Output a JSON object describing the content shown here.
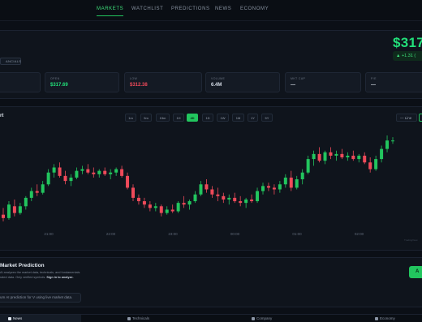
{
  "nav": {
    "items": [
      {
        "label": "MARKETS",
        "active": true
      },
      {
        "label": "WATCHLIST",
        "active": false
      },
      {
        "label": "PREDICTIONS",
        "active": false
      },
      {
        "label": "NEWS",
        "active": false
      },
      {
        "label": "ECONOMY",
        "active": false
      }
    ]
  },
  "header": {
    "badge": "ANCIALS",
    "price": "$317",
    "change": "▲ +1.31 ("
  },
  "stats": [
    {
      "label": "",
      "value": ""
    },
    {
      "label": "OPEN",
      "value": "$317.69",
      "tone": "green"
    },
    {
      "label": "LOW",
      "value": "$312.38",
      "tone": "red"
    },
    {
      "label": "VOLUME",
      "value": "6.4M",
      "tone": "plain"
    },
    {
      "label": "MKT CAP",
      "value": "—",
      "tone": "plain"
    },
    {
      "label": "P/E",
      "value": "—",
      "tone": "plain"
    }
  ],
  "chart_panel": {
    "title": "rt",
    "timeframes": [
      "1m",
      "5m",
      "15m",
      "1H",
      "4D",
      "1D",
      "1W",
      "1M",
      "1Y",
      "5Y"
    ],
    "timeframe_active": "4D",
    "chart_type": "— Line",
    "x_ticks": [
      "21:00",
      "22:00",
      "23:00",
      "00:00",
      "01:00",
      "02:00"
    ],
    "watermark": "TradingView"
  },
  "chart_data": {
    "type": "candlestick",
    "x_ticks": [
      "21:00",
      "22:00",
      "23:00",
      "00:00",
      "01:00",
      "02:00"
    ],
    "up_color": "#22c55e",
    "down_color": "#ef4a5a",
    "candles": [
      {
        "o": 312.8,
        "h": 313.2,
        "l": 312.4,
        "c": 312.6
      },
      {
        "o": 312.6,
        "h": 313.6,
        "l": 312.5,
        "c": 313.4
      },
      {
        "o": 313.3,
        "h": 313.7,
        "l": 312.7,
        "c": 312.9
      },
      {
        "o": 312.9,
        "h": 313.5,
        "l": 312.8,
        "c": 313.3
      },
      {
        "o": 313.3,
        "h": 313.9,
        "l": 313.1,
        "c": 313.8
      },
      {
        "o": 313.8,
        "h": 314.4,
        "l": 313.6,
        "c": 314.2
      },
      {
        "o": 314.2,
        "h": 314.6,
        "l": 313.9,
        "c": 314.1
      },
      {
        "o": 314.1,
        "h": 314.8,
        "l": 314.0,
        "c": 314.6
      },
      {
        "o": 314.6,
        "h": 315.5,
        "l": 314.5,
        "c": 315.3
      },
      {
        "o": 315.3,
        "h": 315.8,
        "l": 315.0,
        "c": 315.6
      },
      {
        "o": 315.6,
        "h": 315.9,
        "l": 315.0,
        "c": 315.1
      },
      {
        "o": 315.1,
        "h": 315.4,
        "l": 314.6,
        "c": 314.8
      },
      {
        "o": 314.8,
        "h": 315.2,
        "l": 314.5,
        "c": 315.0
      },
      {
        "o": 315.0,
        "h": 315.6,
        "l": 314.9,
        "c": 315.4
      },
      {
        "o": 315.4,
        "h": 315.7,
        "l": 315.2,
        "c": 315.5
      },
      {
        "o": 315.5,
        "h": 315.8,
        "l": 315.2,
        "c": 315.3
      },
      {
        "o": 315.3,
        "h": 315.6,
        "l": 315.0,
        "c": 315.2
      },
      {
        "o": 315.2,
        "h": 315.5,
        "l": 315.0,
        "c": 315.4
      },
      {
        "o": 315.4,
        "h": 315.6,
        "l": 315.1,
        "c": 315.2
      },
      {
        "o": 315.2,
        "h": 315.5,
        "l": 314.9,
        "c": 315.3
      },
      {
        "o": 315.3,
        "h": 315.6,
        "l": 315.1,
        "c": 315.5
      },
      {
        "o": 315.5,
        "h": 315.7,
        "l": 315.0,
        "c": 315.1
      },
      {
        "o": 315.1,
        "h": 315.3,
        "l": 314.3,
        "c": 314.4
      },
      {
        "o": 314.4,
        "h": 314.6,
        "l": 313.6,
        "c": 313.8
      },
      {
        "o": 313.8,
        "h": 314.0,
        "l": 313.4,
        "c": 313.6
      },
      {
        "o": 313.6,
        "h": 313.8,
        "l": 313.2,
        "c": 313.4
      },
      {
        "o": 313.4,
        "h": 313.6,
        "l": 313.0,
        "c": 313.2
      },
      {
        "o": 313.2,
        "h": 313.5,
        "l": 313.0,
        "c": 313.3
      },
      {
        "o": 313.3,
        "h": 313.4,
        "l": 312.7,
        "c": 312.9
      },
      {
        "o": 312.9,
        "h": 313.3,
        "l": 312.8,
        "c": 313.1
      },
      {
        "o": 313.1,
        "h": 313.4,
        "l": 312.9,
        "c": 313.0
      },
      {
        "o": 313.0,
        "h": 313.6,
        "l": 312.9,
        "c": 313.5
      },
      {
        "o": 313.5,
        "h": 313.9,
        "l": 313.2,
        "c": 313.4
      },
      {
        "o": 313.4,
        "h": 313.7,
        "l": 313.1,
        "c": 313.6
      },
      {
        "o": 313.6,
        "h": 314.2,
        "l": 313.5,
        "c": 314.0
      },
      {
        "o": 314.0,
        "h": 314.8,
        "l": 313.9,
        "c": 314.6
      },
      {
        "o": 314.6,
        "h": 314.9,
        "l": 314.1,
        "c": 314.3
      },
      {
        "o": 314.3,
        "h": 314.5,
        "l": 313.8,
        "c": 314.0
      },
      {
        "o": 314.0,
        "h": 314.4,
        "l": 313.6,
        "c": 313.9
      },
      {
        "o": 313.9,
        "h": 314.1,
        "l": 313.5,
        "c": 313.7
      },
      {
        "o": 313.7,
        "h": 314.0,
        "l": 313.4,
        "c": 313.8
      },
      {
        "o": 313.8,
        "h": 314.1,
        "l": 313.5,
        "c": 313.6
      },
      {
        "o": 313.6,
        "h": 313.9,
        "l": 313.3,
        "c": 313.5
      },
      {
        "o": 313.5,
        "h": 313.8,
        "l": 313.2,
        "c": 313.7
      },
      {
        "o": 313.7,
        "h": 314.0,
        "l": 313.5,
        "c": 313.6
      },
      {
        "o": 313.6,
        "h": 314.4,
        "l": 313.5,
        "c": 314.2
      },
      {
        "o": 314.2,
        "h": 314.7,
        "l": 314.0,
        "c": 314.5
      },
      {
        "o": 314.5,
        "h": 314.7,
        "l": 314.2,
        "c": 314.4
      },
      {
        "o": 314.4,
        "h": 314.6,
        "l": 314.0,
        "c": 314.3
      },
      {
        "o": 314.3,
        "h": 314.8,
        "l": 314.1,
        "c": 314.6
      },
      {
        "o": 314.6,
        "h": 315.2,
        "l": 314.4,
        "c": 315.0
      },
      {
        "o": 315.0,
        "h": 315.4,
        "l": 314.2,
        "c": 314.4
      },
      {
        "o": 314.4,
        "h": 315.1,
        "l": 314.3,
        "c": 314.9
      },
      {
        "o": 314.9,
        "h": 315.5,
        "l": 314.6,
        "c": 315.3
      },
      {
        "o": 315.3,
        "h": 316.3,
        "l": 315.2,
        "c": 316.1
      },
      {
        "o": 316.1,
        "h": 316.6,
        "l": 315.7,
        "c": 316.4
      },
      {
        "o": 316.4,
        "h": 316.8,
        "l": 315.9,
        "c": 316.0
      },
      {
        "o": 316.0,
        "h": 316.6,
        "l": 315.8,
        "c": 316.5
      },
      {
        "o": 316.5,
        "h": 316.8,
        "l": 316.1,
        "c": 316.3
      },
      {
        "o": 316.3,
        "h": 316.6,
        "l": 316.0,
        "c": 316.4
      },
      {
        "o": 316.4,
        "h": 316.7,
        "l": 316.1,
        "c": 316.2
      },
      {
        "o": 316.2,
        "h": 316.5,
        "l": 316.0,
        "c": 316.3
      },
      {
        "o": 316.3,
        "h": 316.6,
        "l": 316.0,
        "c": 316.1
      },
      {
        "o": 316.1,
        "h": 316.4,
        "l": 315.9,
        "c": 316.3
      },
      {
        "o": 316.3,
        "h": 316.5,
        "l": 315.8,
        "c": 315.9
      },
      {
        "o": 315.9,
        "h": 316.2,
        "l": 315.3,
        "c": 315.5
      },
      {
        "o": 315.5,
        "h": 316.3,
        "l": 315.4,
        "c": 316.1
      },
      {
        "o": 316.1,
        "h": 316.9,
        "l": 315.9,
        "c": 316.7
      },
      {
        "o": 316.7,
        "h": 317.5,
        "l": 316.5,
        "c": 317.2
      },
      {
        "o": 317.2,
        "h": 317.4,
        "l": 317.0,
        "c": 317.2
      }
    ]
  },
  "prediction": {
    "title": "Market Prediction",
    "desc_1": "AI analyzes the market data, technicals, and fundamentals",
    "desc_2": "rated data. Only verified symbols.",
    "signin": "Sign in to analyze.",
    "button": "A",
    "input_text": "um AI prediction for V using live market data."
  },
  "bottom_tabs": [
    {
      "label": "News",
      "active": true
    },
    {
      "label": "Technicals",
      "active": false
    },
    {
      "label": "Company",
      "active": false
    },
    {
      "label": "Economy",
      "active": false
    }
  ]
}
